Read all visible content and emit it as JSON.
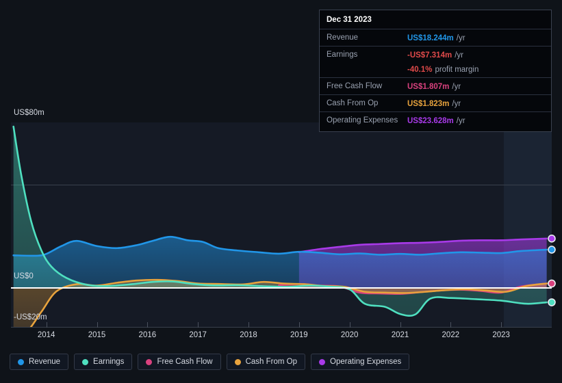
{
  "colors": {
    "revenue": "#2196e8",
    "earnings": "#4fe0c0",
    "free_cash_flow": "#d9417e",
    "cash_from_op": "#e8a33d",
    "operating_expenses": "#a83ae8",
    "negative_text": "#e04a4a",
    "plot_bg": "#151a25",
    "page_bg": "#0f1319",
    "forecast_band": "#1b2433"
  },
  "tooltip": {
    "title": "Dec 31 2023",
    "rows": [
      {
        "label": "Revenue",
        "value": "US$18.244m",
        "unit": "/yr",
        "color": "#2196e8"
      },
      {
        "label": "Earnings",
        "value": "-US$7.314m",
        "unit": "/yr",
        "color": "#e04a4a"
      },
      {
        "label": "",
        "value": "-40.1%",
        "unit": "profit margin",
        "color": "#e04a4a"
      },
      {
        "label": "Free Cash Flow",
        "value": "US$1.807m",
        "unit": "/yr",
        "color": "#d9417e"
      },
      {
        "label": "Cash From Op",
        "value": "US$1.823m",
        "unit": "/yr",
        "color": "#e8a33d"
      },
      {
        "label": "Operating Expenses",
        "value": "US$23.628m",
        "unit": "/yr",
        "color": "#a83ae8"
      }
    ]
  },
  "legend": {
    "items": [
      {
        "label": "Revenue",
        "color": "#2196e8"
      },
      {
        "label": "Earnings",
        "color": "#4fe0c0"
      },
      {
        "label": "Free Cash Flow",
        "color": "#d9417e"
      },
      {
        "label": "Cash From Op",
        "color": "#e8a33d"
      },
      {
        "label": "Operating Expenses",
        "color": "#a83ae8"
      }
    ]
  },
  "chart_data": {
    "type": "area",
    "title": "",
    "xlabel": "",
    "ylabel": "",
    "ylim": [
      -20,
      80
    ],
    "y_ticks": [
      {
        "label": "US$80m",
        "value": 80
      },
      {
        "label": "US$0",
        "value": 0
      },
      {
        "label": "-US$20m",
        "value": -20
      }
    ],
    "gridlines": [
      40
    ],
    "zero_line": 0,
    "x_ticks": [
      "2014",
      "2015",
      "2016",
      "2017",
      "2018",
      "2019",
      "2020",
      "2021",
      "2022",
      "2023"
    ],
    "x_range": [
      2013.3,
      2024.0
    ],
    "forecast_start": "2023.4",
    "units": "US$ millions per year",
    "series": [
      {
        "name": "Revenue",
        "color": "#2196e8",
        "x": [
          2013.35,
          2013.8,
          2014.0,
          2014.3,
          2014.6,
          2015.0,
          2015.4,
          2015.8,
          2016.1,
          2016.45,
          2016.8,
          2017.1,
          2017.4,
          2017.8,
          2018.2,
          2018.6,
          2019.0,
          2019.4,
          2019.8,
          2020.2,
          2020.6,
          2021.0,
          2021.4,
          2021.8,
          2022.2,
          2022.6,
          2023.0,
          2023.4,
          2023.9
        ],
        "values": [
          15.5,
          15.3,
          16.2,
          20.0,
          22.5,
          20.0,
          19.0,
          20.5,
          22.5,
          24.5,
          22.8,
          22.0,
          19.0,
          17.8,
          17.0,
          16.3,
          17.2,
          16.8,
          16.0,
          16.4,
          15.8,
          16.2,
          15.8,
          16.5,
          17.0,
          16.8,
          16.6,
          17.6,
          18.244
        ]
      },
      {
        "name": "Earnings",
        "color": "#4fe0c0",
        "x": [
          2013.35,
          2013.5,
          2013.7,
          2013.9,
          2014.1,
          2014.4,
          2014.8,
          2015.2,
          2015.7,
          2016.1,
          2016.5,
          2016.9,
          2017.3,
          2017.8,
          2018.3,
          2018.8,
          2019.2,
          2019.6,
          2020.0,
          2020.3,
          2020.7,
          2021.0,
          2021.3,
          2021.6,
          2022.0,
          2022.5,
          2023.0,
          2023.5,
          2023.9
        ],
        "values": [
          78.0,
          55.0,
          32.0,
          18.0,
          10.0,
          4.5,
          1.2,
          0.6,
          1.5,
          2.6,
          2.8,
          1.6,
          0.9,
          1.0,
          0.5,
          0.2,
          0.8,
          0.3,
          -1.0,
          -8.0,
          -9.5,
          -13.0,
          -13.2,
          -5.5,
          -5.2,
          -5.8,
          -6.5,
          -8.0,
          -7.314
        ]
      },
      {
        "name": "Free Cash Flow",
        "color": "#d9417e",
        "x": [
          2018.6,
          2019.0,
          2019.4,
          2019.8,
          2020.2,
          2020.6,
          2021.0,
          2021.4,
          2021.8,
          2022.2,
          2022.6,
          2023.0,
          2023.4,
          2023.9
        ],
        "values": [
          1.0,
          1.6,
          0.8,
          0.4,
          -2.6,
          -3.0,
          -3.2,
          -2.4,
          -1.6,
          -1.2,
          -1.8,
          -2.6,
          0.4,
          1.807
        ]
      },
      {
        "name": "Cash From Op",
        "color": "#e8a33d",
        "x": [
          2013.35,
          2013.6,
          2013.9,
          2014.2,
          2014.6,
          2015.0,
          2015.4,
          2015.8,
          2016.2,
          2016.6,
          2017.0,
          2017.4,
          2017.9,
          2018.3,
          2018.7,
          2019.1,
          2019.5,
          2019.9,
          2020.3,
          2020.7,
          2021.1,
          2021.5,
          2021.9,
          2022.3,
          2022.7,
          2023.1,
          2023.5,
          2023.9
        ],
        "values": [
          -23.0,
          -22.0,
          -12.0,
          -2.0,
          1.5,
          0.8,
          2.2,
          3.3,
          3.6,
          3.0,
          1.8,
          1.6,
          1.4,
          2.6,
          1.8,
          1.5,
          0.6,
          0.2,
          -2.2,
          -2.6,
          -2.8,
          -2.2,
          -1.4,
          -1.0,
          -1.6,
          -2.2,
          0.6,
          1.823
        ]
      },
      {
        "name": "Operating Expenses",
        "color": "#a83ae8",
        "x": [
          2019.0,
          2019.4,
          2019.8,
          2020.2,
          2020.6,
          2021.0,
          2021.4,
          2021.8,
          2022.2,
          2022.6,
          2023.0,
          2023.4,
          2023.9
        ],
        "values": [
          17.0,
          18.5,
          19.6,
          20.6,
          21.0,
          21.4,
          21.6,
          22.0,
          22.6,
          22.8,
          22.8,
          23.2,
          23.628
        ]
      }
    ],
    "end_markers": [
      {
        "name": "Operating Expenses",
        "value": 23.628,
        "color": "#a83ae8"
      },
      {
        "name": "Revenue",
        "value": 18.244,
        "color": "#2196e8"
      },
      {
        "name": "Cash From Op",
        "value": 1.823,
        "color": "#e8a33d"
      },
      {
        "name": "Free Cash Flow",
        "value": 1.807,
        "color": "#d9417e"
      },
      {
        "name": "Earnings",
        "value": -7.314,
        "color": "#4fe0c0"
      }
    ]
  }
}
